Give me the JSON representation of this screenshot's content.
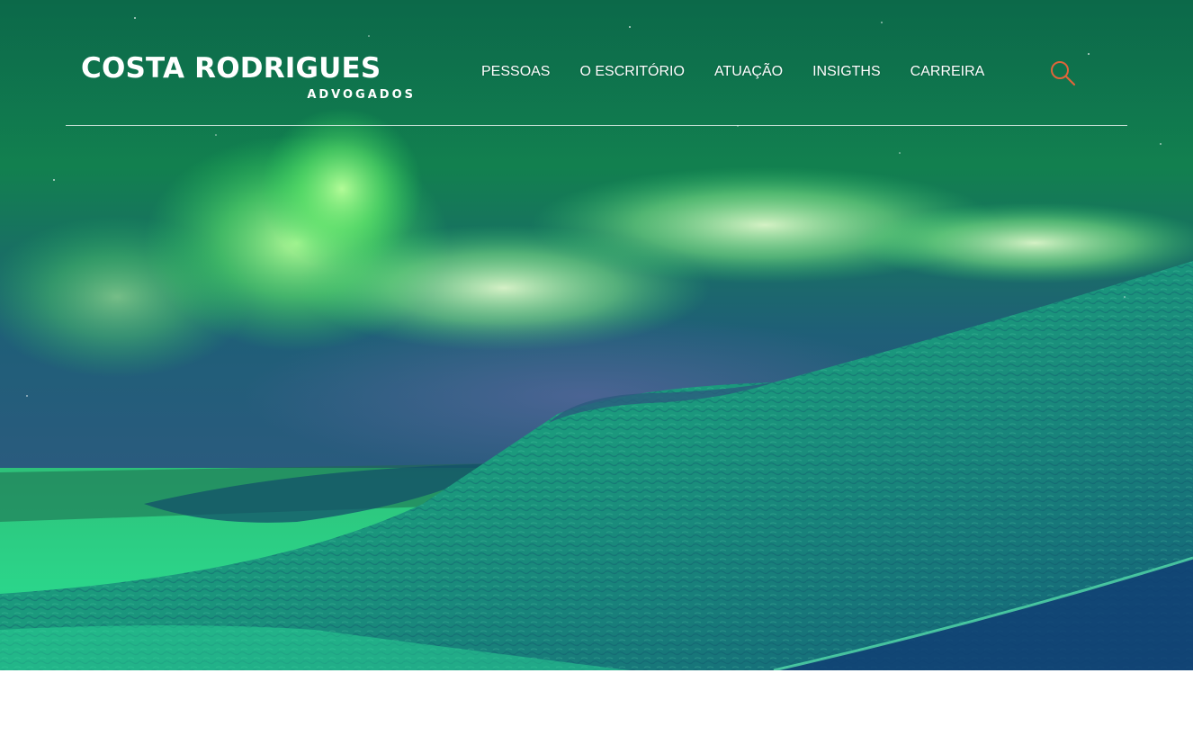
{
  "brand": {
    "name": "COSTA RODRIGUES",
    "tagline": "ADVOGADOS"
  },
  "nav": {
    "items": [
      {
        "label": "PESSOAS"
      },
      {
        "label": "O ESCRITÓRIO"
      },
      {
        "label": "ATUAÇÃO"
      },
      {
        "label": "INSIGTHS"
      },
      {
        "label": "CARREIRA"
      }
    ],
    "search_icon": "search-icon"
  },
  "colors": {
    "accent": "#e0653a",
    "nav_text": "#ffffff",
    "divider": "#d9e3df"
  },
  "hero": {
    "image": "aurora-over-snow-dunes"
  }
}
